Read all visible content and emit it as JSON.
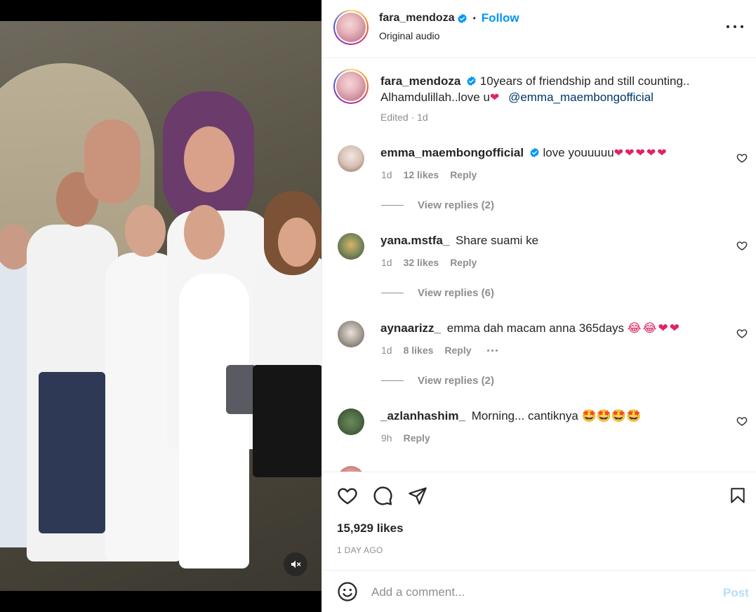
{
  "post": {
    "username": "fara_mendoza",
    "follow_label": "Follow",
    "separator": "•",
    "audio_label": "Original audio",
    "caption_text": "10years of friendship and still counting..",
    "caption_text2": "Alhamdulillah..love u",
    "caption_mention": "@emma_maembongofficial",
    "caption_meta": "Edited · 1d"
  },
  "comments": [
    {
      "username": "emma_maembongofficial",
      "verified": true,
      "text": "love youuuuu",
      "emoji": "❤❤❤❤❤",
      "time": "1d",
      "likes": "12 likes",
      "reply_label": "Reply",
      "view_replies": "View replies (2)"
    },
    {
      "username": "yana.mstfa_",
      "text": "Share suami ke",
      "time": "1d",
      "likes": "32 likes",
      "reply_label": "Reply",
      "view_replies": "View replies (6)"
    },
    {
      "username": "aynaarizz_",
      "text": "emma dah macam anna 365days",
      "emoji": "😂😂❤❤",
      "time": "1d",
      "likes": "8 likes",
      "reply_label": "Reply",
      "view_replies": "View replies (2)"
    },
    {
      "username": "_azlanhashim_",
      "text": "Morning... cantiknya",
      "emoji": "🤩🤩🤩🤩",
      "time": "9h",
      "reply_label": "Reply"
    }
  ],
  "actions": {
    "likes_count": "15,929 likes",
    "time_ago": "1 DAY AGO"
  },
  "composer": {
    "placeholder": "Add a comment...",
    "post_label": "Post"
  },
  "icons": {
    "verified": "verified-badge-icon",
    "more": "more-options-icon",
    "like": "heart-icon",
    "comment": "comment-bubble-icon",
    "share": "paper-plane-icon",
    "save": "bookmark-icon",
    "emoji": "smiley-icon",
    "mute": "speaker-muted-icon"
  },
  "colors": {
    "accent": "#0095f6",
    "verified": "#0095f6",
    "heart": "#e0245e",
    "muted_text": "#8e8e8e",
    "post_disabled": "#b2dffc"
  }
}
